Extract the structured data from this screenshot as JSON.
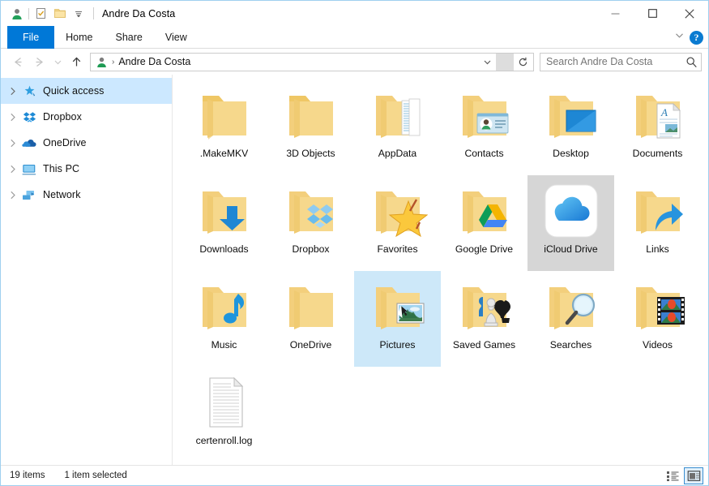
{
  "window": {
    "title": "Andre Da Costa",
    "quick_access_toolbar": [
      {
        "name": "user-account-icon",
        "label": "Properties"
      },
      {
        "name": "properties-icon",
        "label": "Properties"
      },
      {
        "name": "new-folder-icon",
        "label": "New folder"
      },
      {
        "name": "customize-qat-chevron-icon",
        "label": "Customize Quick Access Toolbar"
      }
    ],
    "controls": {
      "minimize": "Minimize",
      "maximize": "Maximize",
      "close": "Close"
    }
  },
  "ribbon": {
    "tabs": [
      {
        "label": "File",
        "active": true
      },
      {
        "label": "Home",
        "active": false
      },
      {
        "label": "Share",
        "active": false
      },
      {
        "label": "View",
        "active": false
      }
    ],
    "expand_label": "Expand the Ribbon",
    "help_label": "?"
  },
  "address": {
    "back_label": "Back",
    "forward_label": "Forward",
    "recent_label": "Recent locations",
    "up_label": "Up",
    "crumb": "Andre Da Costa",
    "crumb_separator": "›",
    "dropdown_label": "Previous locations",
    "refresh_label": "Refresh"
  },
  "search": {
    "placeholder": "Search Andre Da Costa",
    "value": ""
  },
  "sidebar": {
    "items": [
      {
        "label": "Quick access",
        "icon": "star-pin-icon",
        "selected": true
      },
      {
        "label": "Dropbox",
        "icon": "dropbox-icon",
        "selected": false
      },
      {
        "label": "OneDrive",
        "icon": "onedrive-cloud-icon",
        "selected": false
      },
      {
        "label": "This PC",
        "icon": "monitor-icon",
        "selected": false
      },
      {
        "label": "Network",
        "icon": "network-icon",
        "selected": false
      }
    ]
  },
  "files": [
    {
      "label": ".MakeMKV",
      "icon": "folder-plain-icon",
      "selection": "none"
    },
    {
      "label": "3D Objects",
      "icon": "folder-plain-icon",
      "selection": "none"
    },
    {
      "label": "AppData",
      "icon": "folder-appdata-icon",
      "selection": "none"
    },
    {
      "label": "Contacts",
      "icon": "folder-contacts-icon",
      "selection": "none"
    },
    {
      "label": "Desktop",
      "icon": "folder-desktop-icon",
      "selection": "none"
    },
    {
      "label": "Documents",
      "icon": "folder-documents-icon",
      "selection": "none"
    },
    {
      "label": "Downloads",
      "icon": "folder-downloads-icon",
      "selection": "none"
    },
    {
      "label": "Dropbox",
      "icon": "folder-dropbox-icon",
      "selection": "none"
    },
    {
      "label": "Favorites",
      "icon": "folder-favorites-icon",
      "selection": "none"
    },
    {
      "label": "Google Drive",
      "icon": "folder-googledrive-icon",
      "selection": "none"
    },
    {
      "label": "iCloud Drive",
      "icon": "icloud-drive-icon",
      "selection": "grey"
    },
    {
      "label": "Links",
      "icon": "folder-links-icon",
      "selection": "none"
    },
    {
      "label": "Music",
      "icon": "folder-music-icon",
      "selection": "none"
    },
    {
      "label": "OneDrive",
      "icon": "folder-plain-icon",
      "selection": "none"
    },
    {
      "label": "Pictures",
      "icon": "folder-pictures-icon",
      "selection": "blue"
    },
    {
      "label": "Saved Games",
      "icon": "folder-savedgames-icon",
      "selection": "none"
    },
    {
      "label": "Searches",
      "icon": "folder-searches-icon",
      "selection": "none"
    },
    {
      "label": "Videos",
      "icon": "folder-videos-icon",
      "selection": "none"
    },
    {
      "label": "certenroll.log",
      "icon": "log-file-icon",
      "selection": "none"
    }
  ],
  "status": {
    "item_count": "19 items",
    "selection_count": "1 item selected",
    "details_view_label": "Details view",
    "large_icons_view_label": "Large icons view"
  },
  "colors": {
    "accent": "#0078d7",
    "selection_blue": "#cde8f9",
    "selection_grey": "#d6d6d6",
    "nav_selected": "#cce8ff",
    "folder_yellow": "#f7d477"
  }
}
